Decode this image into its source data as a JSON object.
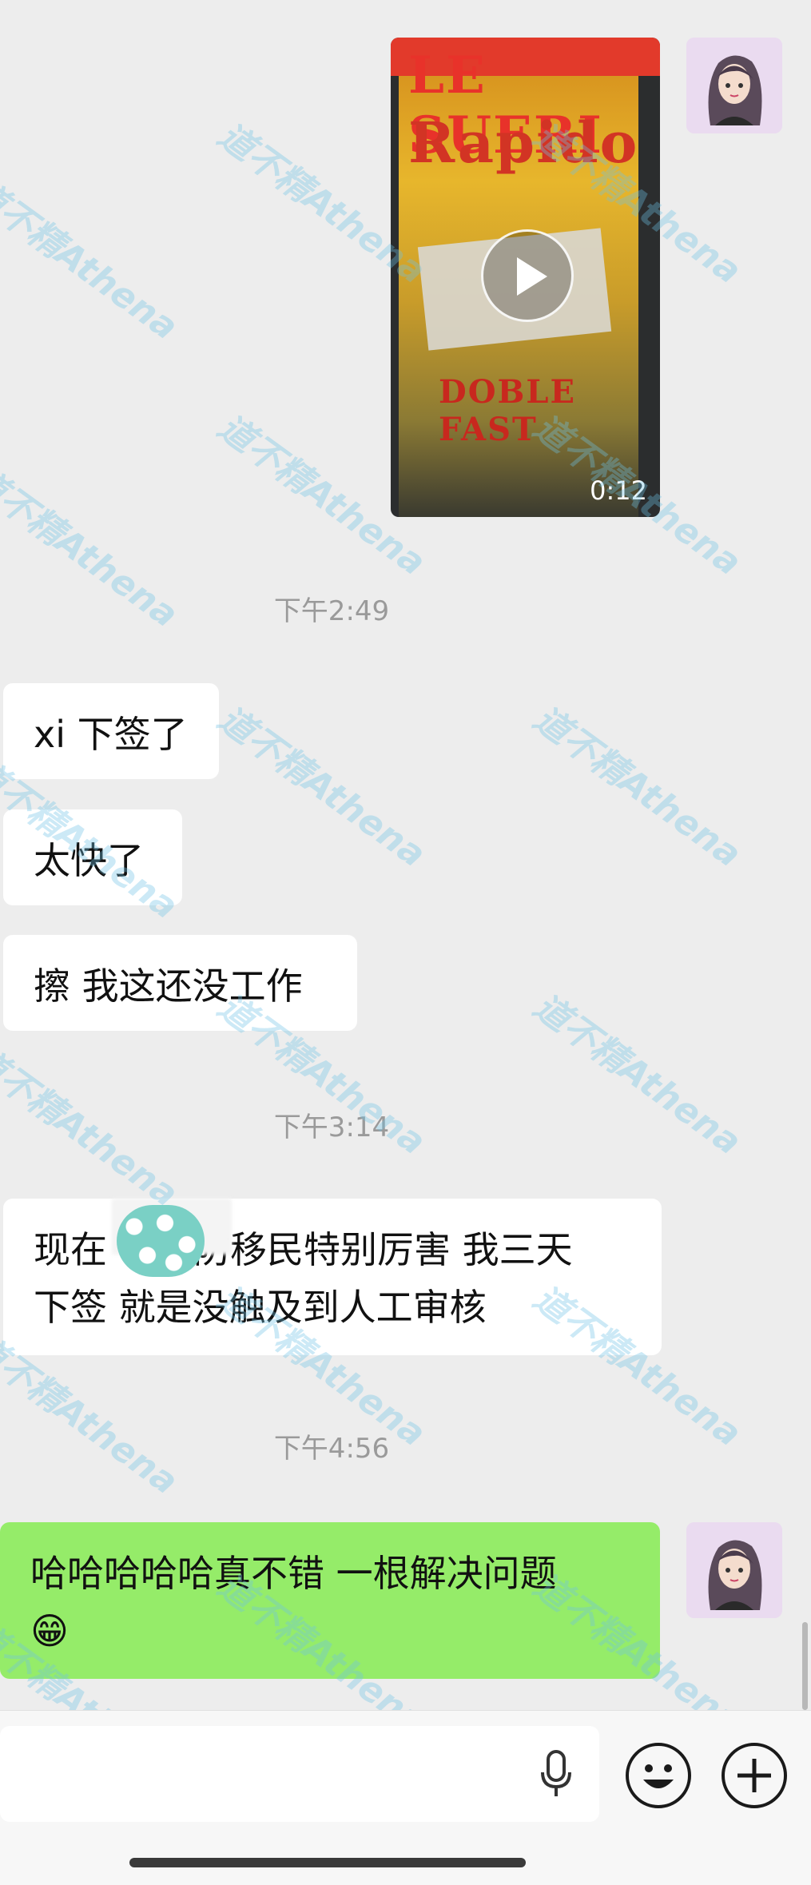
{
  "chat": {
    "messages": [
      {
        "kind": "video",
        "from": "me",
        "duration": "0:12"
      },
      {
        "kind": "time",
        "text": "下午2:49"
      },
      {
        "kind": "text",
        "from": "other",
        "text": "xi 下签了"
      },
      {
        "kind": "text",
        "from": "other",
        "text": "太快了"
      },
      {
        "kind": "text",
        "from": "other",
        "text": "擦 我这还没工作"
      },
      {
        "kind": "time",
        "text": "下午3:14"
      },
      {
        "kind": "text",
        "from": "other",
        "line1": "现在",
        "line1b": "防移民特别厉害 我三天",
        "line2": "下签 就是没触及到人工审核"
      },
      {
        "kind": "time",
        "text": "下午4:56"
      },
      {
        "kind": "text",
        "from": "me",
        "line1": "哈哈哈哈哈真不错 一根解决问题",
        "emoji": "😁"
      }
    ]
  },
  "video_overlay": {
    "title_line1": "LE SUERI",
    "title_line2": "Rapido",
    "bottom_line": "DOBLE FAST"
  },
  "watermark": {
    "text": "道不精Athena"
  },
  "input_bar": {
    "mic_icon": "microphone-icon",
    "emoji_icon": "smiley-icon",
    "plus_icon": "plus-circle-icon"
  },
  "colors": {
    "background": "#ededed",
    "my_bubble": "#95ec69",
    "their_bubble": "#ffffff",
    "time_text": "#9a9a9a"
  }
}
